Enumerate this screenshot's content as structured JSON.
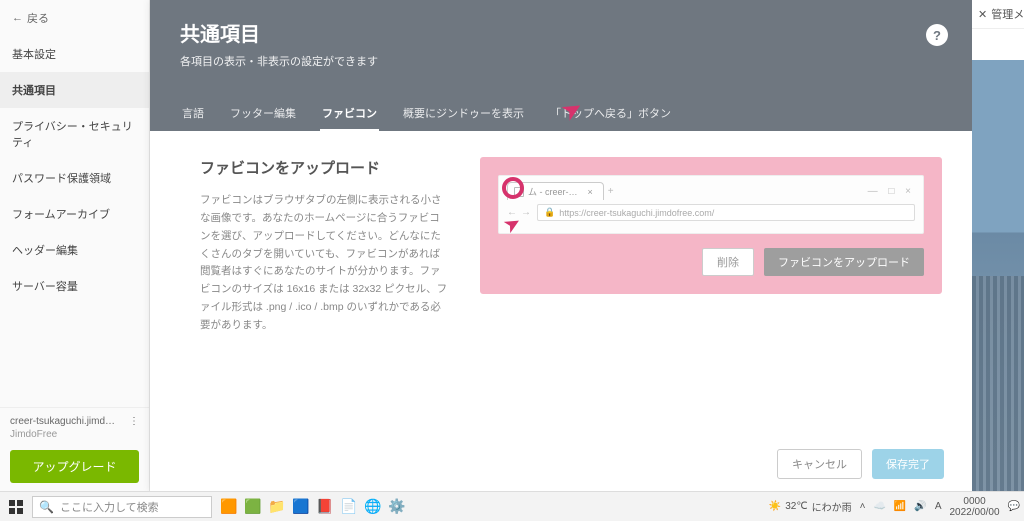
{
  "sidebar": {
    "back": "戻る",
    "items": [
      {
        "label": "基本設定",
        "active": false
      },
      {
        "label": "共通項目",
        "active": true
      },
      {
        "label": "プライバシー・セキュリティ",
        "active": false
      },
      {
        "label": "パスワード保護領域",
        "active": false
      },
      {
        "label": "フォームアーカイブ",
        "active": false
      },
      {
        "label": "ヘッダー編集",
        "active": false
      },
      {
        "label": "サーバー容量",
        "active": false
      }
    ],
    "site_id": "creer-tsukaguchi.jimd…",
    "plan": "JimdoFree",
    "more_icon": "⋮",
    "upgrade": "アップグレード"
  },
  "header": {
    "title": "共通項目",
    "subtitle": "各項目の表示・非表示の設定ができます",
    "help": "?",
    "tabs": [
      {
        "label": "言語",
        "active": false
      },
      {
        "label": "フッター編集",
        "active": false
      },
      {
        "label": "ファビコン",
        "active": true
      },
      {
        "label": "概要にジンドゥーを表示",
        "active": false
      },
      {
        "label": "「トップへ戻る」ボタン",
        "active": false
      }
    ]
  },
  "content": {
    "heading": "ファビコンをアップロード",
    "desc": "ファビコンはブラウザタブの左側に表示される小さな画像です。あなたのホームページに合うファビコンを選び、アップロードしてください。どんなにたくさんのタブを開いていても、ファビコンがあれば閲覧者はすぐにあなたのサイトが分かります。ファビコンのサイズは 16x16 または 32x32 ピクセル、ファイル形式は .png / .ico / .bmp のいずれかである必要があります。"
  },
  "preview": {
    "tab_title": "ム - creer-…",
    "new_tab_tooltip": "×",
    "plus": "+",
    "window_controls": "— □ ×",
    "nav_back": "←",
    "nav_fwd": "→",
    "url_lock": "🔒",
    "url": "https://creer-tsukaguchi.jimdofree.com/",
    "delete_btn": "削除",
    "upload_btn": "ファビコンをアップロード"
  },
  "footer": {
    "cancel": "キャンセル",
    "save": "保存完了"
  },
  "right": {
    "close": "管理メニ",
    "close_x": "✕"
  },
  "taskbar": {
    "search_placeholder": "ここに入力して検索",
    "weather_temp": "32℃",
    "weather_label": "にわか雨",
    "time": "0000",
    "date": "2022/00/00"
  }
}
